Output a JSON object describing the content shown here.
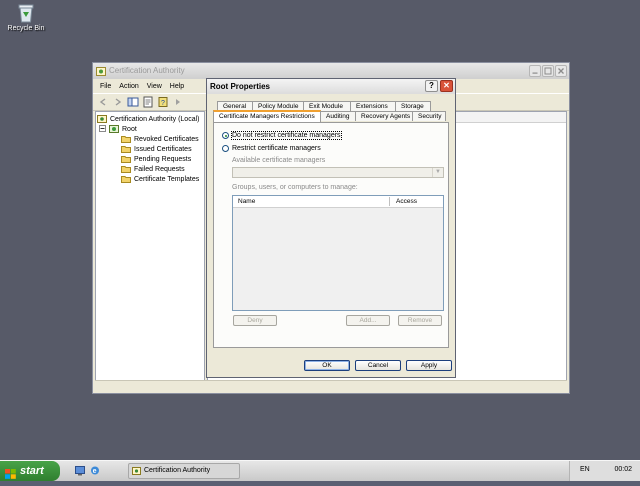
{
  "desktop": {
    "recycle_label": "Recycle Bin"
  },
  "mmc": {
    "title": "Certification Authority",
    "menu": [
      "File",
      "Action",
      "View",
      "Help"
    ],
    "tree": {
      "root_label": "Certification Authority (Local)",
      "ca_label": "Root",
      "children": [
        "Revoked Certificates",
        "Issued Certificates",
        "Pending Requests",
        "Failed Requests",
        "Certificate Templates"
      ]
    }
  },
  "dialog": {
    "title": "Root Properties",
    "help_glyph": "?",
    "close_glyph": "✕",
    "tabs_row1": [
      "General",
      "Policy Module",
      "Exit Module",
      "Extensions",
      "Storage"
    ],
    "tabs_row2": [
      "Certificate Managers Restrictions",
      "Auditing",
      "Recovery Agents",
      "Security"
    ],
    "radio_unrestricted": "Do not restrict certificate managers",
    "radio_restricted": "Restrict certificate managers",
    "available_label": "Available certificate managers",
    "groups_label": "Groups, users, or computers to manage:",
    "col_name": "Name",
    "col_access": "Access",
    "deny_button": "Deny",
    "add_button": "Add...",
    "remove_button": "Remove",
    "ok_button": "OK",
    "cancel_button": "Cancel",
    "apply_button": "Apply"
  },
  "taskbar": {
    "start_label": "start",
    "task_label": "Certification Authority",
    "lang": "EN",
    "clock": "00:02"
  }
}
